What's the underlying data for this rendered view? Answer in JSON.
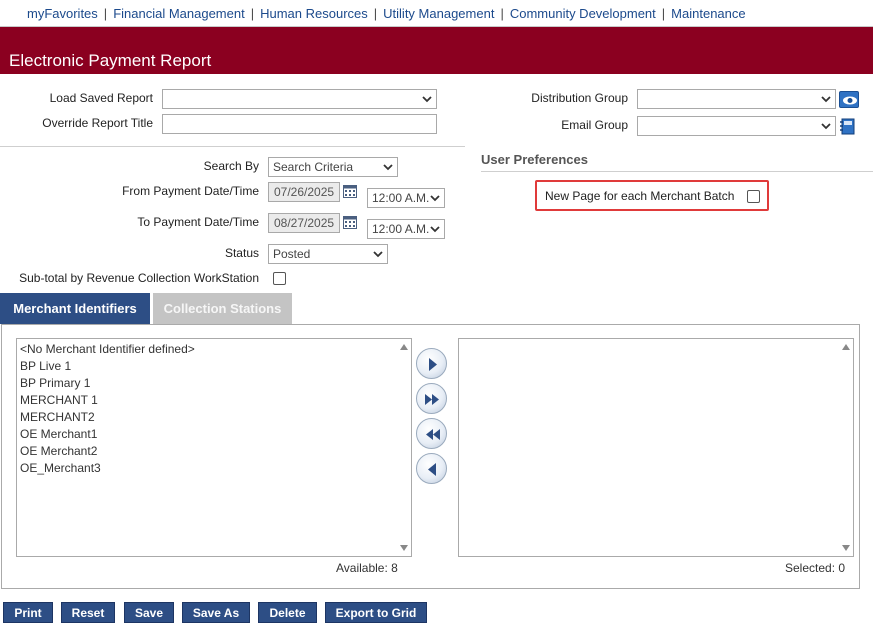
{
  "nav": {
    "items": [
      "myFavorites",
      "Financial Management",
      "Human Resources",
      "Utility Management",
      "Community Development",
      "Maintenance"
    ],
    "separator": "|"
  },
  "page": {
    "title": "Electronic Payment Report"
  },
  "report": {
    "load_saved_label": "Load Saved Report",
    "load_saved_value": "",
    "override_title_label": "Override Report Title",
    "override_title_value": "",
    "distribution_group_label": "Distribution Group",
    "distribution_group_value": "",
    "email_group_label": "Email Group",
    "email_group_value": ""
  },
  "criteria": {
    "search_by_label": "Search By",
    "search_by_value": "Search Criteria",
    "from_date_label": "From Payment Date/Time",
    "from_date_value": "07/26/2025",
    "from_time_value": "12:00 A.M.",
    "to_date_label": "To Payment Date/Time",
    "to_date_value": "08/27/2025",
    "to_time_value": "12:00 A.M.",
    "status_label": "Status",
    "status_value": "Posted",
    "subtotal_label": "Sub-total by Revenue Collection WorkStation",
    "subtotal_checked": false
  },
  "preferences": {
    "title": "User Preferences",
    "new_page_label": "New Page for each Merchant Batch",
    "new_page_checked": false
  },
  "tabs": [
    {
      "label": "Merchant Identifiers",
      "active": true
    },
    {
      "label": "Collection Stations",
      "active": false
    }
  ],
  "available": {
    "items": [
      "<No Merchant Identifier defined>",
      "BP Live 1",
      "BP Primary 1",
      "MERCHANT 1",
      "MERCHANT2",
      "OE Merchant1",
      "OE Merchant2",
      "OE_Merchant3"
    ],
    "count_text": "Available: 8"
  },
  "selected": {
    "items": [],
    "count_text": "Selected: 0"
  },
  "transfer": {
    "move_right_icon": "arrow-right-icon",
    "move_all_right_icon": "double-arrow-right-icon",
    "move_all_left_icon": "double-arrow-left-icon",
    "move_left_icon": "arrow-left-icon"
  },
  "actions": {
    "print": "Print",
    "reset": "Reset",
    "save": "Save",
    "save_as": "Save As",
    "delete": "Delete",
    "export": "Export to Grid"
  },
  "colors": {
    "title_bar": "#8b0020",
    "nav_link": "#1c4a8c",
    "button": "#2d4e85",
    "highlight": "#e03a3a"
  }
}
